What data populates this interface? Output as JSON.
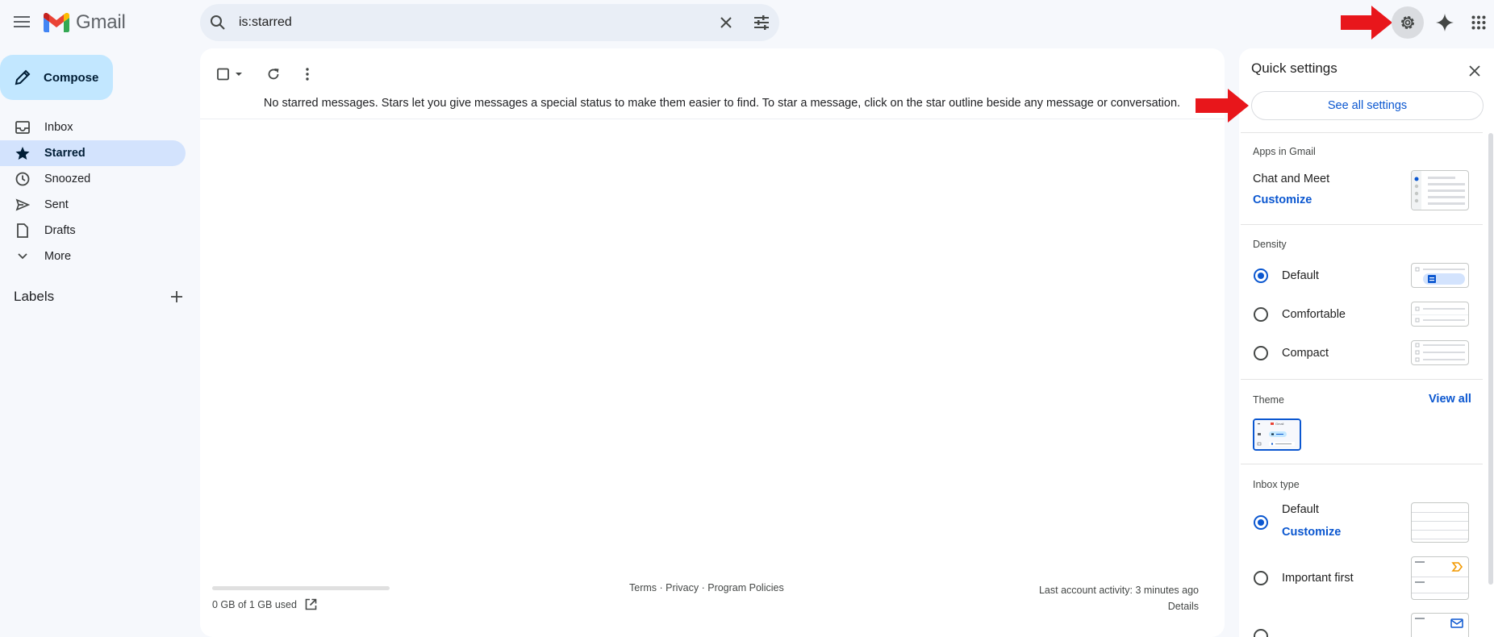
{
  "app": {
    "name": "Gmail"
  },
  "search": {
    "query": "is:starred"
  },
  "compose": {
    "label": "Compose"
  },
  "nav": {
    "items": [
      {
        "label": "Inbox",
        "icon": "inbox-icon"
      },
      {
        "label": "Starred",
        "icon": "star-icon",
        "active": true
      },
      {
        "label": "Snoozed",
        "icon": "clock-icon"
      },
      {
        "label": "Sent",
        "icon": "send-icon"
      },
      {
        "label": "Drafts",
        "icon": "draft-icon"
      },
      {
        "label": "More",
        "icon": "chevron-down-icon"
      }
    ],
    "labels_heading": "Labels"
  },
  "main": {
    "empty_message": "No starred messages. Stars let you give messages a special status to make them easier to find. To star a message, click on the star outline beside any message or conversation.",
    "storage": {
      "text": "0 GB of 1 GB used",
      "used_fraction": 0.0
    },
    "footer": {
      "terms": "Terms",
      "privacy": "Privacy",
      "program_policies": "Program Policies",
      "separator": " · "
    },
    "activity": {
      "text": "Last account activity: 3 minutes ago",
      "details": "Details"
    }
  },
  "quick_settings": {
    "title": "Quick settings",
    "see_all": "See all settings",
    "apps_section": "Apps in Gmail",
    "chat_meet": "Chat and Meet",
    "customize": "Customize",
    "density_section": "Density",
    "density_options": [
      {
        "label": "Default",
        "selected": true
      },
      {
        "label": "Comfortable",
        "selected": false
      },
      {
        "label": "Compact",
        "selected": false
      }
    ],
    "theme_section": "Theme",
    "view_all": "View all",
    "theme_thumb_text": "Gmail",
    "inbox_type_section": "Inbox type",
    "inbox_options": [
      {
        "label": "Default",
        "selected": true,
        "sub_link": "Customize"
      },
      {
        "label": "Important first",
        "selected": false
      }
    ]
  },
  "colors": {
    "accent": "#0b57d0",
    "active_nav": "#d3e3fd",
    "compose_bg": "#c2e7ff",
    "annotation_arrow": "#e8161b"
  }
}
